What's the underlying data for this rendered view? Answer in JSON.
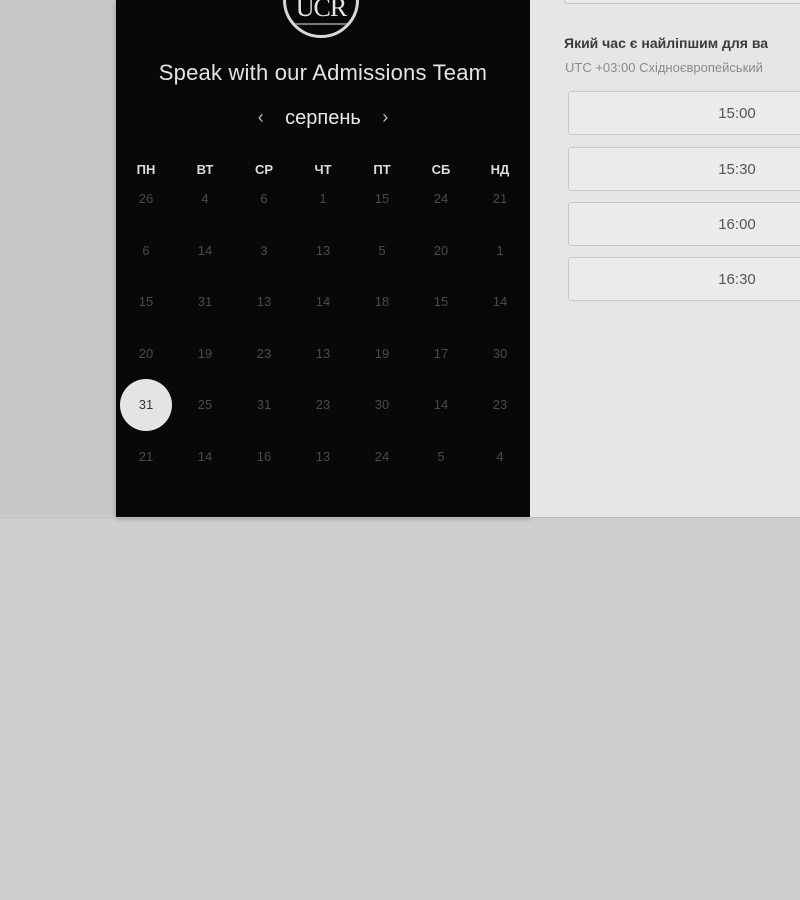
{
  "logo": {
    "text": "UCR"
  },
  "calendar": {
    "title": "Speak with our Admissions Team",
    "month": "серпень",
    "prev_icon": "chevron-left-icon",
    "next_icon": "chevron-right-icon",
    "weekdays": [
      "ПН",
      "ВТ",
      "СР",
      "ЧТ",
      "ПТ",
      "СБ",
      "НД"
    ],
    "weeks": [
      [
        "26",
        "4",
        "6",
        "1",
        "15",
        "24",
        "21"
      ],
      [
        "6",
        "14",
        "3",
        "13",
        "5",
        "20",
        "1"
      ],
      [
        "15",
        "31",
        "13",
        "14",
        "18",
        "15",
        "14"
      ],
      [
        "20",
        "19",
        "23",
        "13",
        "19",
        "17",
        "30"
      ],
      [
        "31",
        "25",
        "31",
        "23",
        "30",
        "14",
        "23"
      ],
      [
        "21",
        "14",
        "16",
        "13",
        "24",
        "5",
        "4"
      ]
    ],
    "selected_day": "31"
  },
  "booking": {
    "question": "Який час є найліпшим для ва",
    "timezone": "UTC +03:00 Східноєвропейський",
    "slots": [
      "15:00",
      "15:30",
      "16:00",
      "16:30"
    ]
  },
  "colors": {
    "panel_bg": "#080808",
    "selected_day_bg": "#e4e4e4",
    "page_bg": "#cfcfcf"
  }
}
